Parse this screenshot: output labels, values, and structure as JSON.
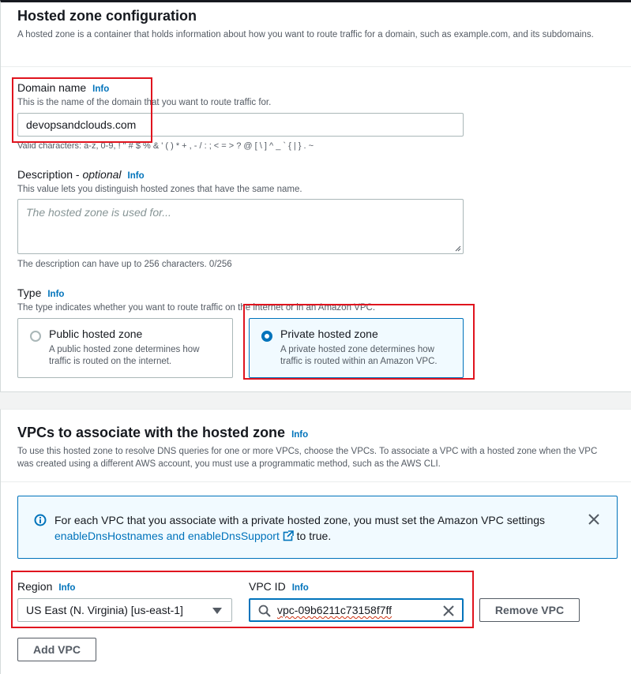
{
  "hosted_zone": {
    "title": "Hosted zone configuration",
    "description": "A hosted zone is a container that holds information about how you want to route traffic for a domain, such as example.com, and its subdomains.",
    "domain": {
      "label": "Domain name",
      "info": "Info",
      "hint": "This is the name of the domain that you want to route traffic for.",
      "value": "devopsandclouds.com",
      "valid_chars": "Valid characters: a-z, 0-9, ! \" # $ % & ' ( ) * + , - / : ; < = > ? @ [ \\ ] ^ _ ` { | } . ~"
    },
    "description_field": {
      "label": "Description - ",
      "label_optional": "optional",
      "info": "Info",
      "hint": "This value lets you distinguish hosted zones that have the same name.",
      "placeholder": "The hosted zone is used for...",
      "constraint": "The description can have up to 256 characters. 0/256"
    },
    "type": {
      "label": "Type",
      "info": "Info",
      "hint": "The type indicates whether you want to route traffic on the internet or in an Amazon VPC.",
      "options": [
        {
          "title": "Public hosted zone",
          "desc": "A public hosted zone determines how traffic is routed on the internet.",
          "selected": false
        },
        {
          "title": "Private hosted zone",
          "desc": "A private hosted zone determines how traffic is routed within an Amazon VPC.",
          "selected": true
        }
      ]
    }
  },
  "vpcs": {
    "title": "VPCs to associate with the hosted zone",
    "info": "Info",
    "description": "To use this hosted zone to resolve DNS queries for one or more VPCs, choose the VPCs. To associate a VPC with a hosted zone when the VPC was created using a different AWS account, you must use a programmatic method, such as the AWS CLI.",
    "alert": {
      "text_before": "For each VPC that you associate with a private hosted zone, you must set the Amazon VPC settings",
      "link": "enableDnsHostnames and enableDnsSupport",
      "text_after": "to true.",
      "info_icon": "info-circle-icon",
      "close_icon": "close-icon",
      "external_icon": "external-link-icon"
    },
    "region": {
      "label": "Region",
      "info": "Info",
      "value": "US East (N. Virginia) [us-east-1]"
    },
    "vpc_id": {
      "label": "VPC ID",
      "info": "Info",
      "value": "vpc-09b6211c73158f7ff"
    },
    "remove_button": "Remove VPC",
    "add_button": "Add VPC"
  },
  "colors": {
    "accent": "#0073bb",
    "highlight_box": "#e0141e",
    "alert_bg": "#f1faff"
  }
}
